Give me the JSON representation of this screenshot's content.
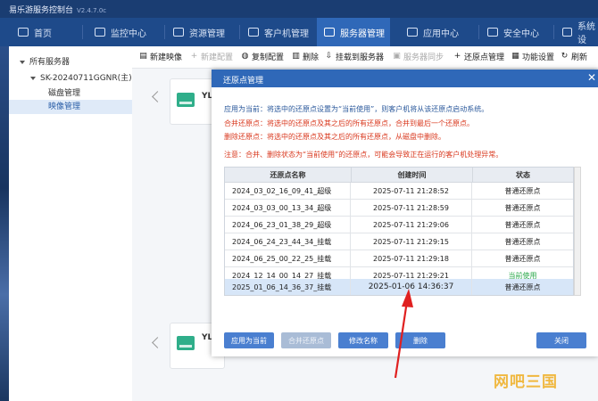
{
  "window": {
    "title": "易乐游服务控制台",
    "version": "V2.4.7.0c"
  },
  "nav": {
    "tabs": [
      {
        "label": "首页",
        "icon": "home-icon"
      },
      {
        "label": "监控中心",
        "icon": "monitor-icon"
      },
      {
        "label": "资源管理",
        "icon": "gamepad-icon"
      },
      {
        "label": "客户机管理",
        "icon": "desktop-icon"
      },
      {
        "label": "服务器管理",
        "icon": "server-icon",
        "active": true
      },
      {
        "label": "应用中心",
        "icon": "apps-icon"
      },
      {
        "label": "安全中心",
        "icon": "shield-icon"
      },
      {
        "label": "系统设",
        "icon": "gear-icon"
      }
    ]
  },
  "sidebar": {
    "root": "所有服务器",
    "server": "SK-20240711GGNR(主)",
    "items": [
      "磁盘管理",
      "映像管理"
    ]
  },
  "toolbar": {
    "items": [
      {
        "label": "新建映像",
        "icon": "new-image-icon",
        "enabled": true
      },
      {
        "label": "新建配置",
        "icon": "plus-icon",
        "enabled": false
      },
      {
        "label": "复制配置",
        "icon": "copy-icon",
        "enabled": true
      },
      {
        "label": "删除",
        "icon": "trash-icon",
        "enabled": true
      },
      {
        "label": "挂载到服务器",
        "icon": "mount-icon",
        "enabled": true
      },
      {
        "label": "服务器同步",
        "icon": "sync-icon",
        "enabled": false
      },
      {
        "label": "还原点管理",
        "icon": "plus-icon",
        "enabled": true
      },
      {
        "label": "功能设置",
        "icon": "settings-icon",
        "enabled": true
      },
      {
        "label": "刷新",
        "icon": "refresh-icon",
        "enabled": true
      }
    ]
  },
  "cards": {
    "label_top": "YL",
    "label_bottom": "YL"
  },
  "dialog": {
    "title": "还原点管理",
    "info": {
      "apply": "应用为当前：将选中的还原点设置为“当前使用”，则客户机将从该还原点启动系统。",
      "merge": "合并还原点：将选中的还原点及其之后的所有还原点，合并到最后一个还原点。",
      "delete": "删除还原点：将选中的还原点及其之后的所有还原点，从磁盘中删除。",
      "warning": "注意：合并、删除状态为“当前使用”的还原点，可能会导致正在运行的客户机处理异常。"
    },
    "columns": [
      "还原点名称",
      "创建时间",
      "状态"
    ],
    "rows": [
      {
        "name": "2024_03_02_16_09_41_超级",
        "time": "2025-07-11 21:28:52",
        "status": "普通还原点"
      },
      {
        "name": "2024_03_03_00_13_34_超级",
        "time": "2025-07-11 21:28:59",
        "status": "普通还原点"
      },
      {
        "name": "2024_06_23_01_38_29_超级",
        "time": "2025-07-11 21:29:06",
        "status": "普通还原点"
      },
      {
        "name": "2024_06_24_23_44_34_挂载",
        "time": "2025-07-11 21:29:15",
        "status": "普通还原点"
      },
      {
        "name": "2024_06_25_00_22_25_挂载",
        "time": "2025-07-11 21:29:18",
        "status": "普通还原点"
      },
      {
        "name": "2024_12_14_00_14_27_挂载",
        "time": "2025-07-11 21:29:21",
        "status": "当前使用"
      },
      {
        "name": "2025_01_06_14_36_37_挂载",
        "time": "2025-01-06 14:36:37",
        "status": "普通还原点",
        "selected": true
      }
    ],
    "buttons": {
      "apply": "应用为当前",
      "merge": "合并还原点",
      "rename": "修改名称",
      "delete": "删除",
      "close": "关闭"
    }
  },
  "watermark": "网吧三国",
  "colors": {
    "nav_bg": "#1e4a8a",
    "accent": "#2f68b8",
    "warning_red": "#d9381e",
    "current_green": "#2aa84a",
    "arrow_red": "#e02020"
  }
}
